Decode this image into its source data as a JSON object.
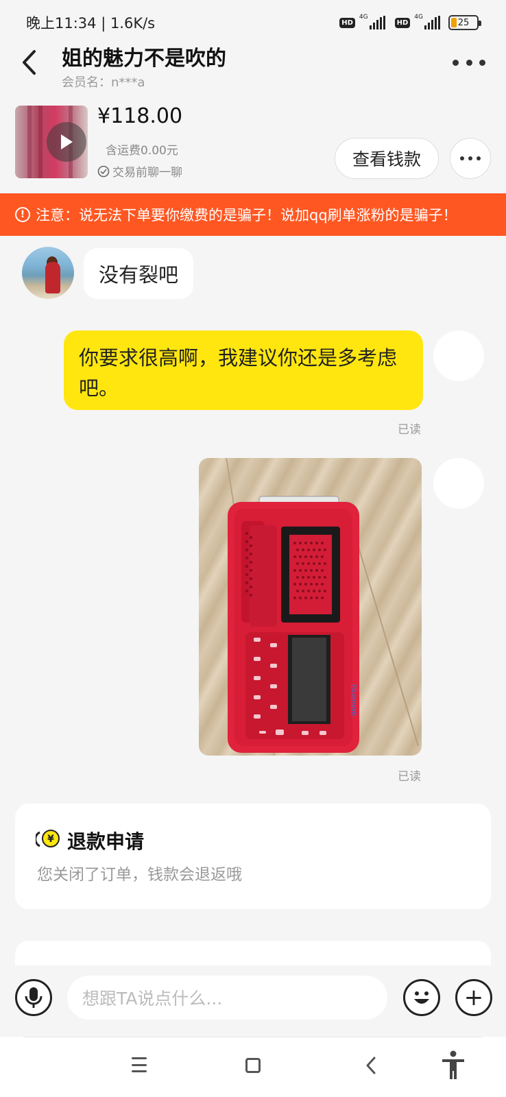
{
  "status_bar": {
    "time": "晚上11:34 | 1.6K/s",
    "hd1": "HD",
    "net1": "4G",
    "hd2": "HD",
    "net2": "4G",
    "battery": "25"
  },
  "header": {
    "title": "姐的魅力不是吹的",
    "member": "会员名：n***a"
  },
  "product": {
    "price": "¥118.00",
    "shipping": "含运费0.00元",
    "chat_first": "交易前聊一聊",
    "view_money_button": "查看钱款"
  },
  "warning": {
    "text": "注意：说无法下单要你缴费的是骗子！说加qq刷单涨粉的是骗子！"
  },
  "messages": [
    {
      "from": "them",
      "text": "没有裂吧"
    },
    {
      "from": "me",
      "text": "你要求很高啊，我建议你还是多考虑吧。",
      "status": "已读"
    },
    {
      "from": "me",
      "type": "image",
      "status": "已读",
      "image_text": "Bluetooth"
    }
  ],
  "refund_card": {
    "title": "退款申请",
    "subtitle": "您关闭了订单，钱款会退返哦"
  },
  "input": {
    "placeholder": "想跟TA说点什么..."
  },
  "icons": {
    "back": "back-arrow-icon",
    "more": "more-dots-icon",
    "play": "play-icon",
    "check": "check-circle-icon",
    "alert": "alert-circle-icon",
    "refund": "yen-coin-icon",
    "mic": "microphone-icon",
    "emoji": "emoji-icon",
    "plus": "plus-icon",
    "nav_menu": "menu-icon",
    "nav_home": "home-square-icon",
    "nav_back": "nav-back-icon",
    "accessibility": "accessibility-icon"
  },
  "colors": {
    "warning_bg": "#ff5722",
    "my_bubble": "#ffe60f",
    "background": "#f5f5f5"
  }
}
